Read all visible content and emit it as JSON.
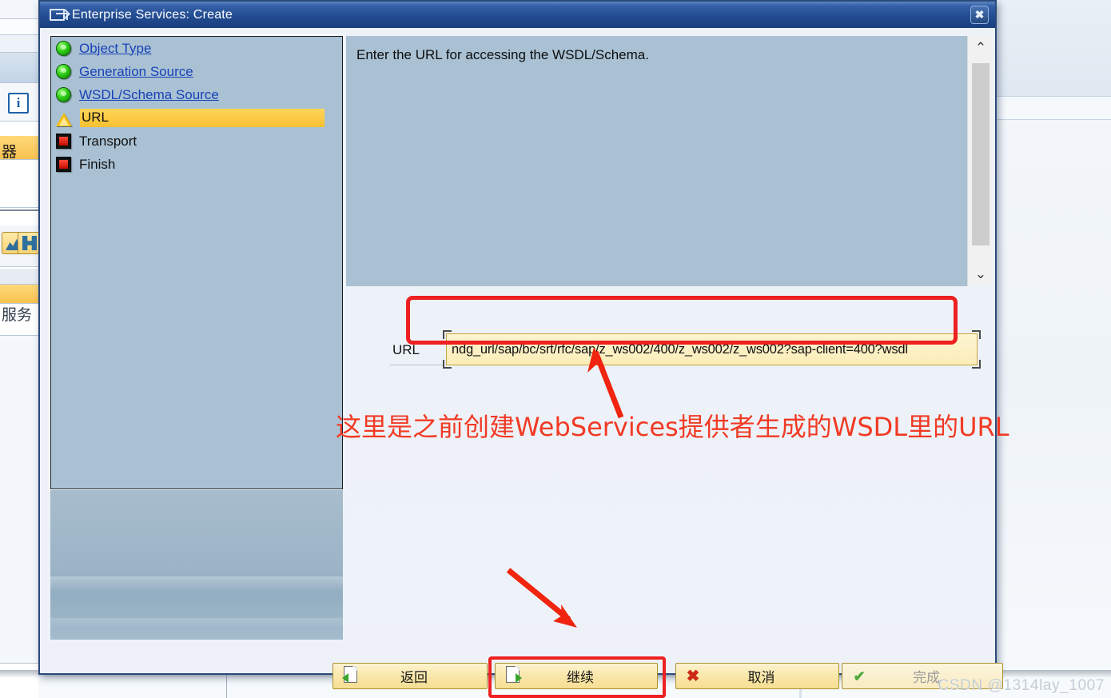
{
  "window": {
    "title": "Enterprise Services: Create",
    "title_icon": "export-window-icon",
    "close_label": "✖"
  },
  "tree": {
    "items": [
      {
        "label": "Object Type",
        "status": "green",
        "link": true
      },
      {
        "label": "Generation Source",
        "status": "green",
        "link": true
      },
      {
        "label": "WSDL/Schema Source",
        "status": "green",
        "link": true
      },
      {
        "label": "URL",
        "status": "warning",
        "link": false,
        "active": true
      },
      {
        "label": "Transport",
        "status": "red",
        "link": false
      },
      {
        "label": "Finish",
        "status": "red",
        "link": false
      }
    ]
  },
  "content": {
    "instruction": "Enter the URL for accessing the WSDL/Schema.",
    "scrollbar": {
      "up": "⌃",
      "down": "⌄"
    }
  },
  "url_field": {
    "label": "URL",
    "value": "ndg_url/sap/bc/srt/rfc/sap/z_ws002/400/z_ws002/z_ws002?sap-client=400?wsdl",
    "placeholder": ""
  },
  "annotation": {
    "text": "这里是之前创建WebServices提供者生成的WSDL里的URL",
    "color": "#f23a24"
  },
  "footer": {
    "buttons": [
      {
        "id": "back",
        "label": "返回",
        "icon": "page-back-icon",
        "disabled": false,
        "highlighted": false
      },
      {
        "id": "continue",
        "label": "继续",
        "icon": "page-forward-icon",
        "disabled": false,
        "highlighted": true
      },
      {
        "id": "cancel",
        "label": "取消",
        "icon": "red-x-icon",
        "disabled": false,
        "highlighted": false
      },
      {
        "id": "finish",
        "label": "完成",
        "icon": "check-pen-icon",
        "disabled": true,
        "highlighted": false
      }
    ]
  },
  "background": {
    "chinese_label_1": "器",
    "chinese_label_2": "服务",
    "info_icon": "i"
  },
  "watermark": "CSDN @1314lay_1007",
  "colors": {
    "titlebar": "#204a8f",
    "tree_panel": "#a9c1d3",
    "highlight_red": "#ee2020",
    "active_row": "#f6c131",
    "button_amber": "#f9e6a8"
  }
}
